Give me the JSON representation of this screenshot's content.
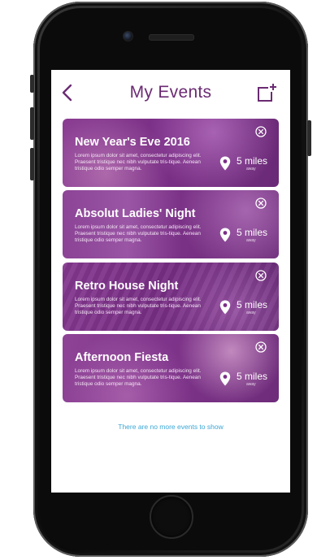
{
  "header": {
    "title": "My Events",
    "back_icon": "chevron-left-icon",
    "add_icon": "add-event-icon"
  },
  "events": [
    {
      "title": "New Year's Eve 2016",
      "description": "Lorem ipsum dolor sit amet, consectetur adipiscing elit. Praesent tristique nec nibh vulputate tris-tique. Aenean tristique odio semper magna.",
      "distance": "5 miles",
      "distance_note": "away"
    },
    {
      "title": "Absolut Ladies' Night",
      "description": "Lorem ipsum dolor sit amet, consectetur adipiscing elit. Praesent tristique nec nibh vulputate tris-tique. Aenean tristique odio semper magna.",
      "distance": "5 miles",
      "distance_note": "away"
    },
    {
      "title": "Retro House Night",
      "description": "Lorem ipsum dolor sit amet, consectetur adipiscing elit. Praesent tristique nec nibh vulputate tris-tique. Aenean tristique odio semper magna.",
      "distance": "5 miles",
      "distance_note": "away"
    },
    {
      "title": "Afternoon Fiesta",
      "description": "Lorem ipsum dolor sit amet, consectetur adipiscing elit. Praesent tristique nec nibh vulputate tris-tique. Aenean tristique odio semper magna.",
      "distance": "5 miles",
      "distance_note": "away"
    }
  ],
  "empty_message": "There are no more events to show",
  "colors": {
    "brand_purple": "#6b2b73",
    "link_blue": "#3aa7d6",
    "card_overlay": "#7a2f86"
  }
}
